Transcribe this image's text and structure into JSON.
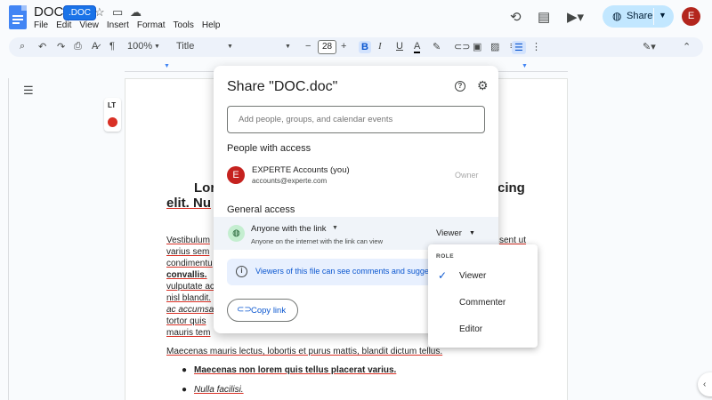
{
  "header": {
    "doc_title": "DOC",
    "badge": ".DOC",
    "menu": [
      "File",
      "Edit",
      "View",
      "Insert",
      "Format",
      "Tools",
      "Help"
    ],
    "share_label": "Share",
    "avatar_letter": "E"
  },
  "toolbar": {
    "zoom": "100%",
    "style": "Title",
    "font": "",
    "font_size": "28"
  },
  "document": {
    "heading_1": "Lor",
    "heading_1b": "cing",
    "heading_2": "elit. Nu",
    "line_1": "Vestibulum",
    "line_1b": "sent ut",
    "line_2": "varius sem",
    "line_3": "condimentu",
    "line_4": "convallis.",
    "line_5": "vulputate ac",
    "line_6": "nisl blandit.",
    "line_7": "ac accumsa",
    "line_8": "tortor quis",
    "line_9": "mauris tem",
    "para_2": "Maecenas mauris lectus, lobortis et purus mattis, blandit dictum tellus.",
    "bullet_1": "Maecenas non lorem quis tellus placerat varius.",
    "bullet_2": "Nulla facilisi."
  },
  "dialog": {
    "title": "Share \"DOC.doc\"",
    "add_placeholder": "Add people, groups, and calendar events",
    "people_heading": "People with access",
    "user_initial": "E",
    "user_name": "EXPERTE Accounts (you)",
    "user_email": "accounts@experte.com",
    "user_role": "Owner",
    "general_heading": "General access",
    "access_title": "Anyone with the link",
    "access_sub": "Anyone on the internet with the link can view",
    "access_role": "Viewer",
    "info_text": "Viewers of this file can see comments and sugge",
    "copy_link": "Copy link"
  },
  "role_menu": {
    "heading": "ROLE",
    "items": [
      "Viewer",
      "Commenter",
      "Editor"
    ],
    "selected": "Viewer"
  },
  "colors": {
    "accent": "#0b57d0",
    "share_bg": "#c2e7ff",
    "info_bg": "#e8f0fe"
  }
}
